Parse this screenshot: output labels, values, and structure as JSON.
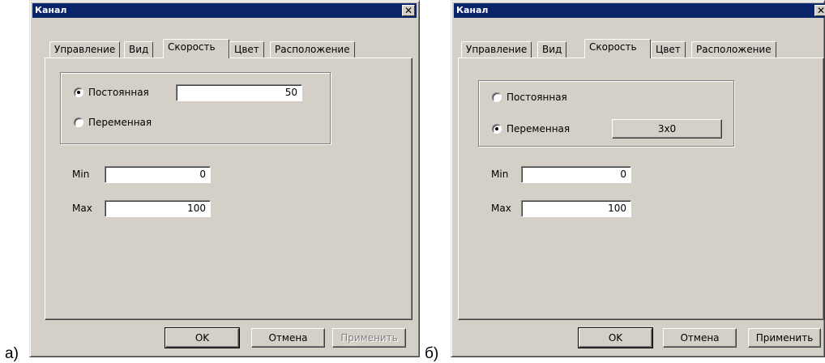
{
  "figure_labels": [
    "а)",
    "б)"
  ],
  "dialogs": [
    {
      "title": "Канал",
      "close_glyph": "✕",
      "tabs": [
        "Управление",
        "Вид",
        "Скорость",
        "Цвет",
        "Расположение"
      ],
      "active_tab": "Скорость",
      "mode": {
        "constant_label": "Постоянная",
        "constant_value": "50",
        "variable_label": "Переменная",
        "selected": "constant"
      },
      "min_label": "Min",
      "min_value": "0",
      "max_label": "Max",
      "max_value": "100",
      "buttons": {
        "ok": "OK",
        "cancel": "Отмена",
        "apply": "Применить",
        "apply_enabled": false
      }
    },
    {
      "title": "Канал",
      "close_glyph": "✕",
      "tabs": [
        "Управление",
        "Вид",
        "Скорость",
        "Цвет",
        "Расположение"
      ],
      "active_tab": "Скорость",
      "mode": {
        "constant_label": "Постоянная",
        "variable_label": "Переменная",
        "variable_button": "3x0",
        "selected": "variable"
      },
      "min_label": "Min",
      "min_value": "0",
      "max_label": "Max",
      "max_value": "100",
      "buttons": {
        "ok": "OK",
        "cancel": "Отмена",
        "apply": "Применить",
        "apply_enabled": true
      }
    }
  ]
}
